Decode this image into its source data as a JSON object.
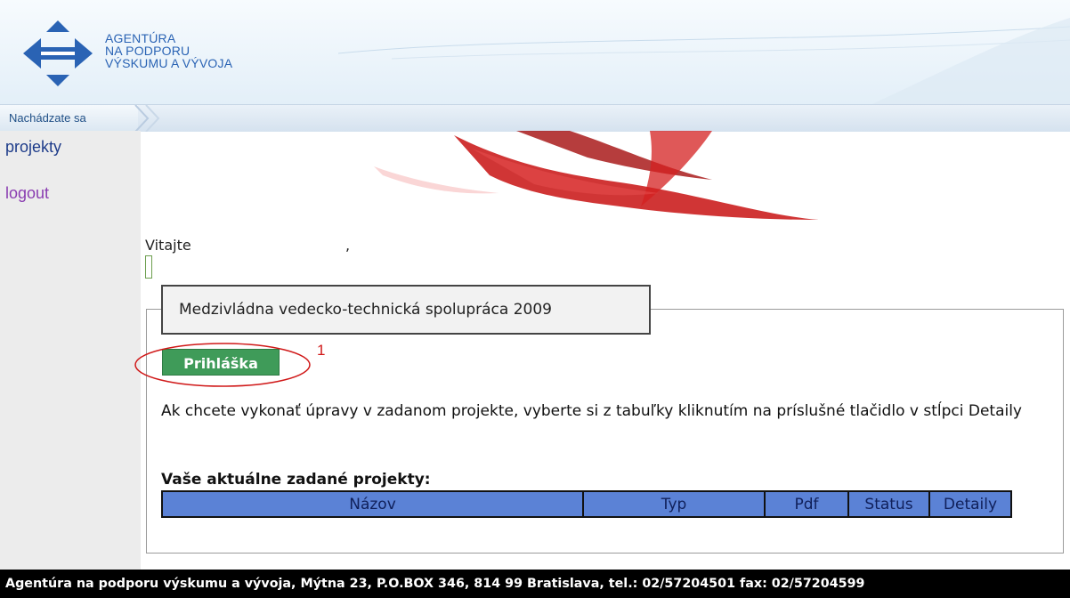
{
  "header": {
    "logo_lines": [
      "AGENTÚRA",
      "NA PODPORU",
      "VÝSKUMU A VÝVOJA"
    ]
  },
  "breadcrumb": {
    "label": "Nachádzate sa"
  },
  "nav": {
    "projekty": "projekty",
    "logout": "logout"
  },
  "main": {
    "welcome": "Vitajte",
    "welcome_comma": ",",
    "program_title": "Medzivládna vedecko-technická spolupráca 2009",
    "apply_button": "Prihláška",
    "annotation_marker": "1",
    "instruction": "Ak chcete vykonať úpravy v zadanom projekte, vyberte si z tabuľky kliknutím na príslušné tlačidlo v stĺpci Detaily",
    "projects_heading": "Vaše aktuálne zadané projekty:",
    "table_headers": [
      "Názov",
      "Typ",
      "Pdf",
      "Status",
      "Detaily"
    ]
  },
  "footer": {
    "text": "Agentúra na podporu výskumu a vývoja, Mýtna 23, P.O.BOX 346, 814 99 Bratislava, tel.: 02/57204501 fax: 02/57204599"
  },
  "colors": {
    "logo_blue": "#2a63b4",
    "button_green": "#3f9b59",
    "table_blue": "#5b82d6",
    "annotation_red": "#d01818"
  }
}
